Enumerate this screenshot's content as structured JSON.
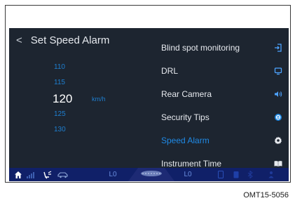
{
  "screen": {
    "title": "Set Speed Alarm",
    "back_glyph": "<"
  },
  "speed_picker": {
    "values": [
      "110",
      "115",
      "120",
      "125",
      "130"
    ],
    "selected_value": "120",
    "unit": "km/h"
  },
  "menu": {
    "items": [
      {
        "label": "Blind spot monitoring",
        "icon": "exit-icon"
      },
      {
        "label": "DRL",
        "icon": "monitor-icon"
      },
      {
        "label": "Rear Camera",
        "icon": "speaker-icon"
      },
      {
        "label": "Security Tips",
        "icon": "target-icon"
      },
      {
        "label": "Speed Alarm",
        "icon": "gear-icon",
        "active": true
      },
      {
        "label": "Instrument Time",
        "icon": "book-icon"
      }
    ]
  },
  "status_bar": {
    "left_fuel_level": "L0",
    "right_fuel_level": "L0"
  },
  "caption": "OMT15-5056",
  "colors": {
    "screen_bg": "#1d2530",
    "accent": "#1f8ae6",
    "status_bar_bg": "#102068"
  }
}
